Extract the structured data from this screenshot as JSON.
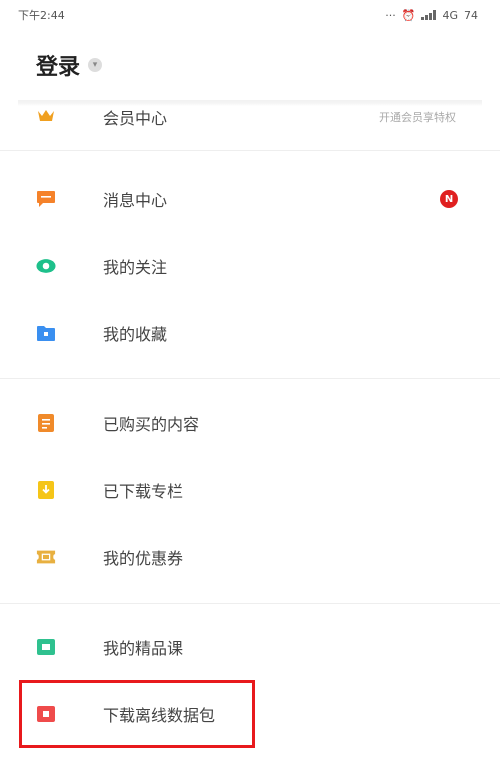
{
  "status_bar": {
    "time": "下午2:44",
    "network": "4G",
    "battery": "74"
  },
  "header": {
    "title": "登录"
  },
  "menu": {
    "member": {
      "label": "会员中心",
      "extra": "开通会员享特权"
    },
    "messages": {
      "label": "消息中心",
      "badge": "N"
    },
    "following": {
      "label": "我的关注"
    },
    "favorites": {
      "label": "我的收藏"
    },
    "purchased": {
      "label": "已购买的内容"
    },
    "downloaded_columns": {
      "label": "已下载专栏"
    },
    "coupons": {
      "label": "我的优惠券"
    },
    "premium_courses": {
      "label": "我的精品课"
    },
    "offline_package": {
      "label": "下载离线数据包"
    }
  },
  "colors": {
    "member": "#f0a020",
    "messages": "#f5822a",
    "following": "#1ec08b",
    "favorites": "#3a8ff0",
    "purchased": "#f08a2a",
    "downloaded": "#f5c518",
    "coupons": "#e8b040",
    "premium": "#2fc18f",
    "offline": "#ef4b4b",
    "highlight": "#e8191c"
  }
}
